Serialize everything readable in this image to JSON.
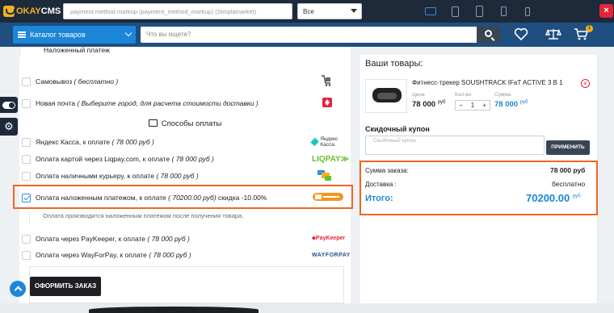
{
  "topbar": {
    "logo_part1": "OKAY",
    "logo_part2": "CMS",
    "markup_placeholder": "payment method markup (payment_method_markup) (Simplamarket)",
    "select_value": "Все",
    "close_label": "×"
  },
  "header": {
    "catalog_label": "Каталог товаров",
    "search_placeholder": "Что вы ищете?",
    "cart_count": "1"
  },
  "delivery": {
    "items": [
      {
        "label": "Наложенный платеж",
        "italic": ""
      },
      {
        "label": "Самовывоз",
        "italic": "( бесплатно )"
      },
      {
        "label": "Новая почта",
        "italic": "( Выберите город, для расчета стоимости доставки )"
      }
    ]
  },
  "payment": {
    "section_title": "Способы оплаты",
    "items": [
      {
        "label": "Яндекс Касса, к оплате",
        "italic": "( 78 000 руб )",
        "logo": "Яндекс Касса"
      },
      {
        "label": "Оплата картой через Liqpay.com, к оплате",
        "italic": "( 78 000 руб )",
        "logo": "LIQPAY"
      },
      {
        "label": "Оплата наличными курьеру, к оплате",
        "italic": "( 78 000 руб )",
        "logo": ""
      },
      {
        "label": "Оплата наложенным платежом, к оплате",
        "italic": "( 70200.00 руб)",
        "extra": "скидка -10.00%",
        "logo": ""
      },
      {
        "label": "Оплата через PayKeeper, к оплате",
        "italic": "( 78 000 руб )",
        "logo": "PayKeeper"
      },
      {
        "label": "Оплата через WayForPay, к оплате",
        "italic": "( 78 000 руб )",
        "logo": "WAYFORPAY"
      }
    ],
    "note": "Оплата производится наложенным платежом после получения товара."
  },
  "order_button": "ОФОРМИТЬ ЗАКАЗ",
  "cart": {
    "title": "Ваши товары:",
    "product_name": "Фитнесс-трекер SOUSHTRACK IFaT ACTIVE 3 В 1",
    "price_label": "Цена",
    "qty_label": "Кол-во",
    "sum_label": "Сумма",
    "price": "78 000",
    "price_currency": "руб",
    "qty": "1",
    "qty_minus": "−",
    "qty_plus": "+",
    "sum": "78 000",
    "sum_currency": "руб",
    "remove_label": "×"
  },
  "coupon": {
    "title": "Скидочный купон",
    "placeholder": "Скидочный купон",
    "apply_label": "ПРИМЕНИТЬ"
  },
  "totals": {
    "order_sum_label": "Сумма заказа:",
    "order_sum_value": "78 000 руб",
    "delivery_label": "Доставка :",
    "delivery_value": "бесплатно",
    "total_label": "Итого:",
    "total_value": "70200.00",
    "total_currency": "руб"
  },
  "colors": {
    "accent": "#1c86d8",
    "highlight": "#f26522",
    "topbar": "#1d2a3a",
    "header": "#1f4e80"
  }
}
